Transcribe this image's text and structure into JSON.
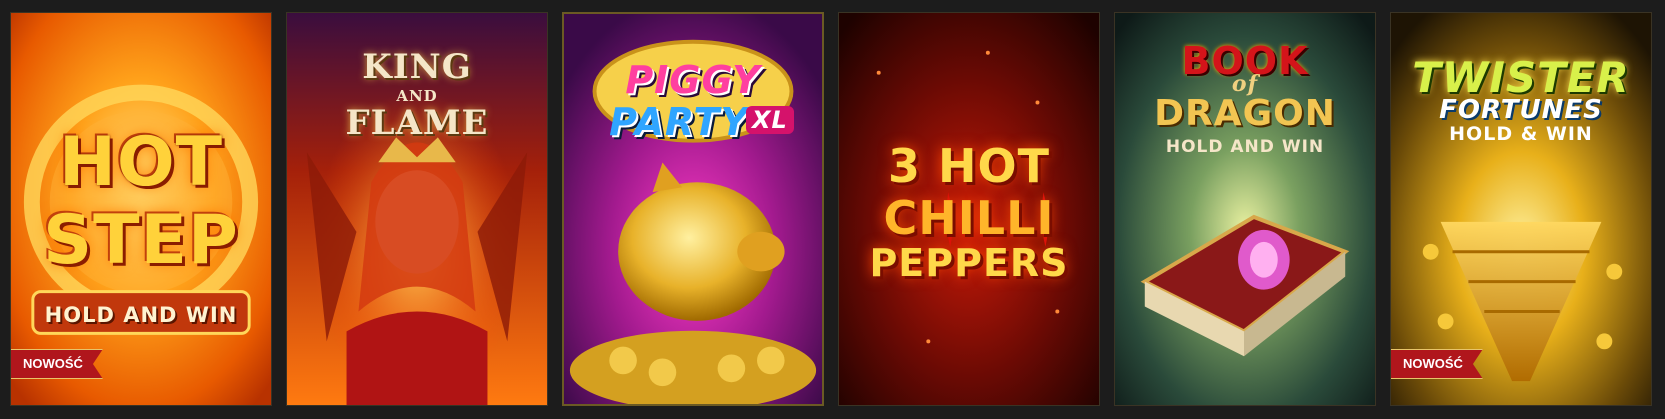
{
  "games": [
    {
      "name": "hot-step",
      "title_lines": [
        "HOT",
        "STEP",
        "HOLD AND WIN"
      ],
      "badge": "NOWOŚĆ"
    },
    {
      "name": "king-and-flame",
      "title_lines": [
        "KING",
        "AND",
        "FLAME"
      ]
    },
    {
      "name": "piggy-party-xl",
      "title_lines": [
        "PIGGY",
        "PARTY",
        "XL"
      ]
    },
    {
      "name": "3-hot-chilli-peppers",
      "title_lines": [
        "3 HOT",
        "CHILLI",
        "PEPPERS"
      ]
    },
    {
      "name": "book-of-dragon",
      "title_lines": [
        "BOOK",
        "of",
        "DRAGON",
        "HOLD AND WIN"
      ]
    },
    {
      "name": "twister-fortunes",
      "title_lines": [
        "TWISTER",
        "FORTUNES",
        "HOLD & WIN"
      ],
      "badge": "NOWOŚĆ"
    }
  ],
  "colors": {
    "page_bg": "#1c1c1c",
    "badge_bg": "#b0161c",
    "selected_border": "#6b5a24"
  }
}
